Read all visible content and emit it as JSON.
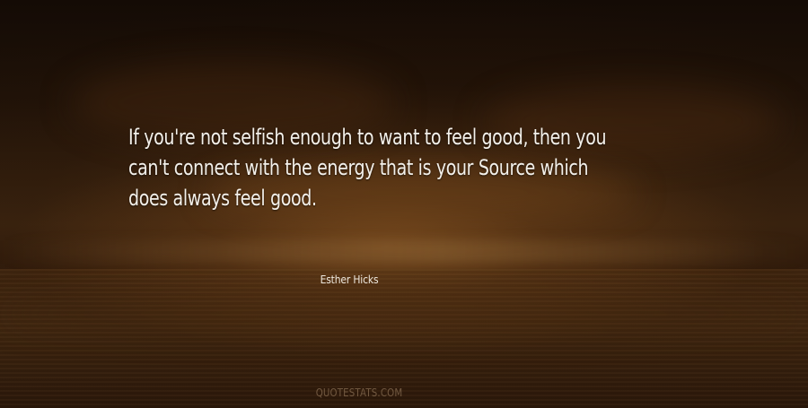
{
  "quote": {
    "lines": [
      "If you're not selfish enough to want to feel good, then you",
      "can't connect with the energy that is your Source which",
      "does always feel good."
    ]
  },
  "author": "Esther Hicks",
  "watermark": "QUOTESTATS.COM",
  "colors": {
    "text": "#f3f0ea",
    "background_dark": "#1a0d05",
    "background_glow": "#8a5a28"
  }
}
